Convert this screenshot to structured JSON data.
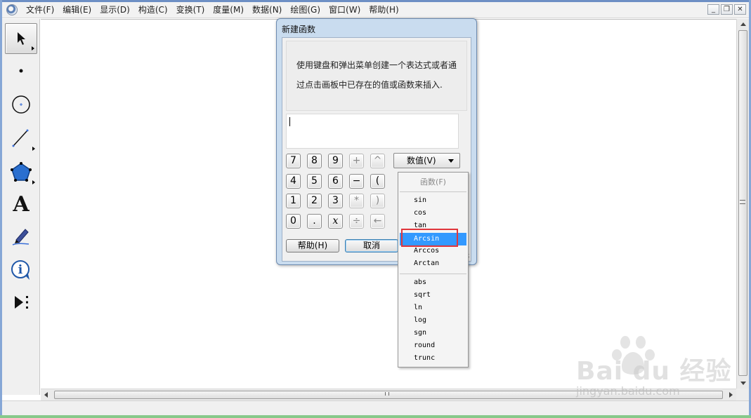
{
  "menubar": {
    "items": [
      "文件(F)",
      "编辑(E)",
      "显示(D)",
      "构造(C)",
      "变换(T)",
      "度量(M)",
      "数据(N)",
      "绘图(G)",
      "窗口(W)",
      "帮助(H)"
    ]
  },
  "window_controls": {
    "minimize": "_",
    "restore": "❐",
    "close": "✕"
  },
  "toolbox": {
    "tools": [
      "arrow-icon",
      "point-icon",
      "compass-icon",
      "straightedge-icon",
      "polygon-icon",
      "text-icon",
      "marker-icon",
      "info-icon",
      "custom-tool-icon"
    ],
    "text_tool_glyph": "A"
  },
  "dialog": {
    "title": "新建函数",
    "instruction_line1": "使用键盘和弹出菜单创建一个表达式或者通",
    "instruction_line2": "过点击画板中已存在的值或函数来插入.",
    "expression": "",
    "keypad": {
      "row1": [
        "7",
        "8",
        "9",
        "+",
        "^"
      ],
      "row2": [
        "4",
        "5",
        "6",
        "−",
        "("
      ],
      "row3": [
        "1",
        "2",
        "3",
        "*",
        ")"
      ],
      "row4": [
        "0",
        ".",
        "x",
        "÷",
        "←"
      ]
    },
    "values_dropdown_label": "数值(V)",
    "help_button": "帮助(H)",
    "cancel_button": "取消"
  },
  "functions_menu": {
    "header": "函数(F)",
    "trig": [
      "sin",
      "cos",
      "tan",
      "Arcsin",
      "Arccos",
      "Arctan"
    ],
    "other": [
      "abs",
      "sqrt",
      "ln",
      "log",
      "sgn",
      "round",
      "trunc"
    ],
    "highlighted": "Arcsin"
  },
  "watermark": {
    "logo": "Bai du 经验",
    "url": "jingyan.baidu.com"
  },
  "colors": {
    "highlight": "#3399ff",
    "annotation_box": "#e0353b",
    "dialog_frame": "#c9dcef"
  }
}
